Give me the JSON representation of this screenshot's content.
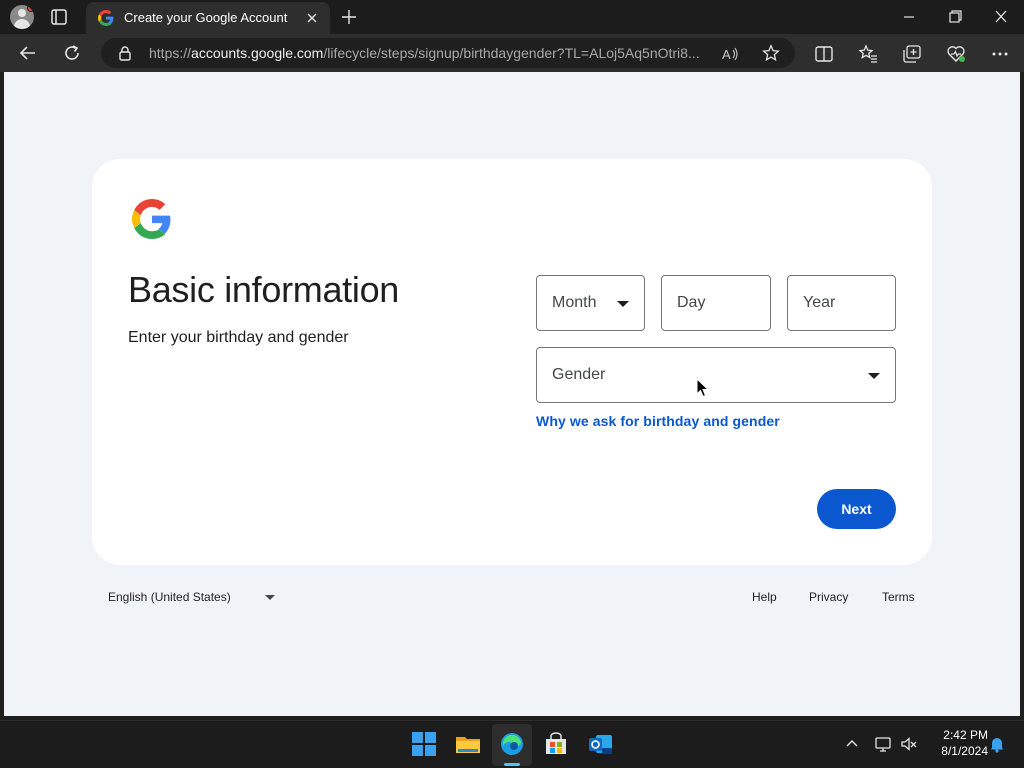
{
  "browser": {
    "tab_title": "Create your Google Account",
    "url_prefix": "https://",
    "url_host": "accounts.google.com",
    "url_path": "/lifecycle/steps/signup/birthdaygender?TL=ALoj5Aq5nOtri8..."
  },
  "page": {
    "heading": "Basic information",
    "subheading": "Enter your birthday and gender",
    "month_label": "Month",
    "day_label": "Day",
    "year_label": "Year",
    "gender_label": "Gender",
    "why_link": "Why we ask for birthday and gender",
    "next_button": "Next"
  },
  "footer": {
    "language": "English (United States)",
    "help": "Help",
    "privacy": "Privacy",
    "terms": "Terms"
  },
  "taskbar": {
    "time": "2:42 PM",
    "date": "8/1/2024"
  },
  "colors": {
    "accent": "#0b57d0",
    "page_bg": "#f0f4f9",
    "card_bg": "#ffffff",
    "chrome_bg": "#1c1c1c"
  }
}
